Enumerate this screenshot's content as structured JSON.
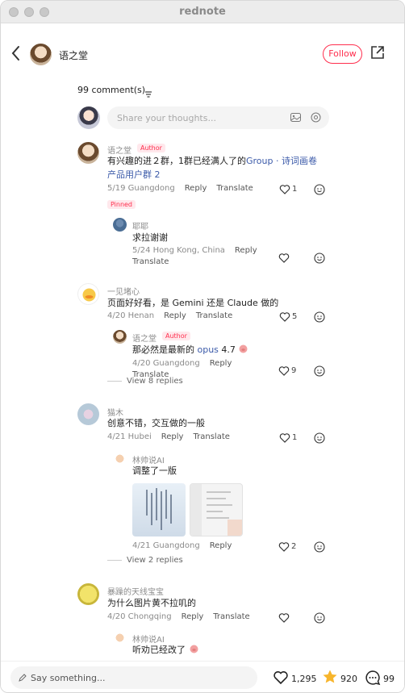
{
  "app": {
    "title": "rednote"
  },
  "header": {
    "author": "语之堂",
    "follow_label": "Follow"
  },
  "comments_header": {
    "count_label": "99 comment(s)"
  },
  "input": {
    "placeholder": "Share your thoughts..."
  },
  "actions": {
    "reply": "Reply",
    "translate": "Translate"
  },
  "comments": [
    {
      "user": "语之堂",
      "tag": "Author",
      "text_a": "有兴趣的进２群，1群已经满人了的",
      "link": "Group · 诗词画卷产品用户群 2",
      "meta": "5/19 Guangdong",
      "likes": "1",
      "pinned": "Pinned",
      "replies": [
        {
          "user": "耶耶",
          "text": "求拉谢谢",
          "meta": "5/24 Hong Kong, China"
        }
      ]
    },
    {
      "user": "一见堵心",
      "text": "页面好好看，是 Gemini 还是 Claude 做的",
      "meta": "4/20 Henan",
      "likes": "5",
      "replies": [
        {
          "user": "语之堂",
          "tag": "Author",
          "text_a": "那必然是最新的 ",
          "link": "opus",
          "text_b": "  4.7",
          "meta": "4/20 Guangdong",
          "likes": "9"
        }
      ],
      "view_more": "View 8 replies"
    },
    {
      "user": "猫木",
      "text": "创意不错，交互做的一般",
      "meta": "4/21 Hubei",
      "likes": "1",
      "replies": [
        {
          "user": "林帅说AI",
          "text": "调整了一版",
          "meta": "4/21 Guangdong",
          "likes": "2"
        }
      ],
      "view_more": "View 2 replies"
    },
    {
      "user": "暴躁的天线宝宝",
      "text": "为什么图片黄不拉叽的",
      "meta": "4/20 Chongqing",
      "replies": [
        {
          "user": "林帅说AI",
          "text": "听劝已经改了"
        }
      ]
    }
  ],
  "bottom_bar": {
    "placeholder": "Say something...",
    "likes": "1,295",
    "stars": "920",
    "comments": "99"
  },
  "colors": {
    "brand": "#ff2e4d",
    "link": "#3b5aa9"
  }
}
